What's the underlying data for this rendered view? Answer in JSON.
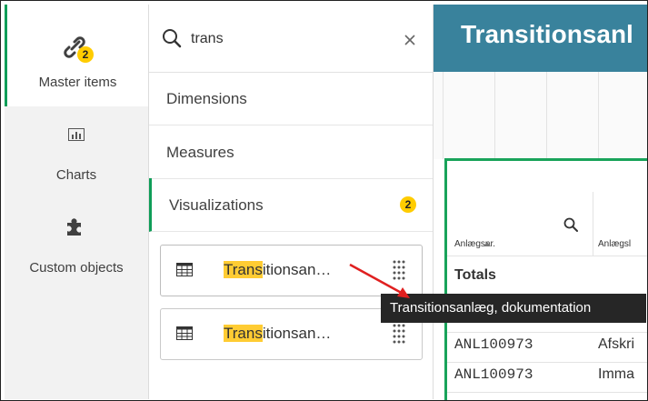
{
  "nav": {
    "master_items": {
      "label": "Master items",
      "badge": "2",
      "icon": "link-icon"
    },
    "charts": {
      "label": "Charts",
      "icon": "bar-chart-icon"
    },
    "custom_objects": {
      "label": "Custom objects",
      "icon": "puzzle-icon"
    }
  },
  "search": {
    "value": "trans",
    "icon": "search-icon",
    "clear_icon": "close-icon"
  },
  "categories": [
    {
      "label": "Dimensions"
    },
    {
      "label": "Measures"
    },
    {
      "label": "Visualizations",
      "badge": "2"
    }
  ],
  "visualizations": [
    {
      "highlight": "Trans",
      "rest": "itionsan…",
      "icon": "table-icon"
    },
    {
      "highlight": "Trans",
      "rest": "itionsan…",
      "icon": "table-icon"
    }
  ],
  "tooltip": "Transitionsanlæg, dokumentation",
  "sheet": {
    "title": "Transitionsanl",
    "table": {
      "headers": [
        "Anlægsnr.",
        "Anlægsl"
      ],
      "totals_label": "Totals",
      "rows": [
        [
          "ANL100973",
          "Afskri"
        ],
        [
          "ANL100973",
          "Imma"
        ]
      ]
    }
  },
  "colors": {
    "accent_green": "#0f9d58",
    "header_blue": "#39829c",
    "badge_yellow": "#ffcc00",
    "highlight": "#ffcc33"
  }
}
